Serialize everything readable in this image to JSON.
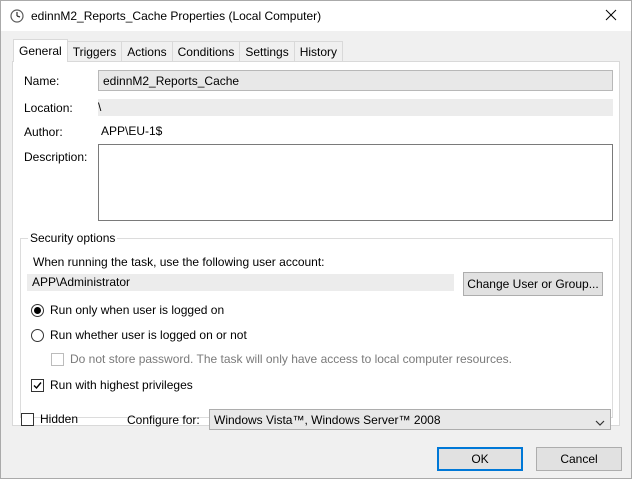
{
  "window": {
    "title": "edinnM2_Reports_Cache Properties (Local Computer)"
  },
  "tabs": [
    {
      "label": "General",
      "active": true
    },
    {
      "label": "Triggers"
    },
    {
      "label": "Actions"
    },
    {
      "label": "Conditions"
    },
    {
      "label": "Settings"
    },
    {
      "label": "History"
    }
  ],
  "general": {
    "name_label": "Name:",
    "name_value": "edinnM2_Reports_Cache",
    "location_label": "Location:",
    "location_value": "\\",
    "author_label": "Author:",
    "author_value": "APP\\EU-1$",
    "description_label": "Description:",
    "description_value": ""
  },
  "security": {
    "group_title": "Security options",
    "account_prompt": "When running the task, use the following user account:",
    "account_value": "APP\\Administrator",
    "change_button": "Change User or Group...",
    "run_logged_on": "Run only when user is logged on",
    "run_whether": "Run whether user is logged on or not",
    "no_store_password": "Do not store password.  The task will only have access to local computer resources.",
    "highest_privileges": "Run with highest privileges"
  },
  "bottom": {
    "hidden_label": "Hidden",
    "configure_label": "Configure for:",
    "configure_value": "Windows Vista™, Windows Server™ 2008",
    "ok_button": "OK",
    "cancel_button": "Cancel"
  },
  "icons": {
    "title": "clock-icon",
    "close": "close-icon",
    "dropdown": "chevron-down-icon",
    "check": "check-icon"
  },
  "colors": {
    "accent": "#0078d7"
  }
}
